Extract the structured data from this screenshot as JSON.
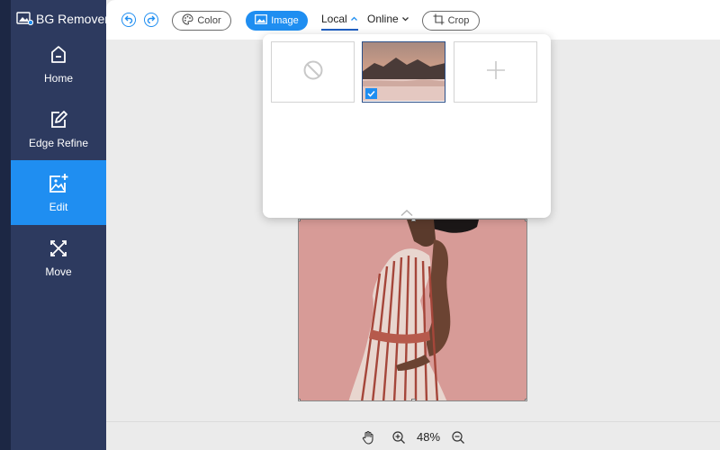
{
  "app": {
    "title": "BG Remover"
  },
  "sidebar": {
    "items": [
      {
        "label": "Home",
        "icon": "home-icon",
        "active": false
      },
      {
        "label": "Edge Refine",
        "icon": "edit-pencil-icon",
        "active": false
      },
      {
        "label": "Edit",
        "icon": "image-add-icon",
        "active": true
      },
      {
        "label": "Move",
        "icon": "move-arrows-icon",
        "active": false
      }
    ]
  },
  "toolbar": {
    "undo_icon": "undo-icon",
    "redo_icon": "redo-icon",
    "color_label": "Color",
    "image_label": "Image",
    "tabs": [
      {
        "label": "Local",
        "active": true
      },
      {
        "label": "Online",
        "active": false
      }
    ],
    "crop_label": "Crop"
  },
  "background_panel": {
    "options": [
      {
        "name": "none",
        "icon": "no-background-icon",
        "selected": false
      },
      {
        "name": "mountain-lake",
        "icon": "mountain-thumbnail",
        "selected": true
      },
      {
        "name": "add",
        "icon": "plus-icon",
        "selected": false
      }
    ]
  },
  "footer": {
    "zoom": "48%"
  },
  "colors": {
    "accent": "#1f8ef1",
    "sidebar": "#2d3a5f",
    "photo_background": "#d79b97"
  }
}
